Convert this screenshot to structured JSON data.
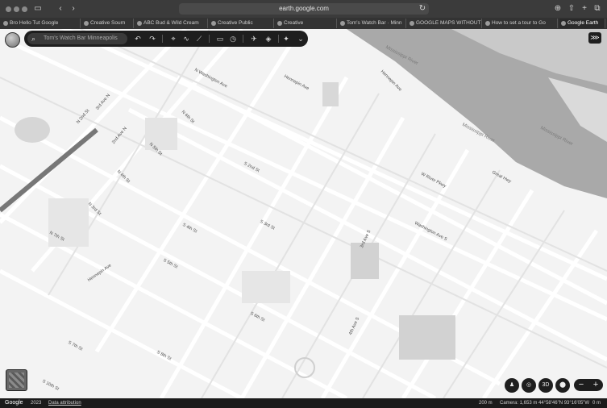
{
  "browser": {
    "url": "earth.google.com",
    "tabs": [
      {
        "label": "Bro Hello Tut Google"
      },
      {
        "label": "Creative Sourn"
      },
      {
        "label": "ABC Bud & Wild Cream"
      },
      {
        "label": "Creative Public"
      },
      {
        "label": "Creative"
      },
      {
        "label": "Tom's Watch Bar · Minn"
      },
      {
        "label": "GOOGLE MAPS WITHOUT"
      },
      {
        "label": "How to set a tour to Go"
      },
      {
        "label": "Google Earth"
      }
    ]
  },
  "toolbar": {
    "search_text": "Tom's Watch Bar",
    "search_context": "Minneapolis",
    "icons": [
      "search-icon",
      "undo-icon",
      "redo-icon",
      "place-icon",
      "path-icon",
      "measure-icon",
      "slideshow-icon",
      "history-icon",
      "satellite-icon",
      "layers-icon",
      "sparkle-icon",
      "chevron-down-icon"
    ]
  },
  "map": {
    "water_labels": [
      {
        "text": "Mississippi River"
      },
      {
        "text": "Mississippi River"
      },
      {
        "text": "Mississippi River"
      }
    ],
    "streets": [
      {
        "text": "N Washington Ave"
      },
      {
        "text": "N 2nd St"
      },
      {
        "text": "N 3rd St"
      },
      {
        "text": "N 4th St"
      },
      {
        "text": "N 5th St"
      },
      {
        "text": "N 6th St"
      },
      {
        "text": "N 7th St"
      },
      {
        "text": "2nd Ave N"
      },
      {
        "text": "3rd Ave N"
      },
      {
        "text": "Hennepin Ave"
      },
      {
        "text": "Hennepin Ave"
      },
      {
        "text": "S 2nd St"
      },
      {
        "text": "S 3rd St"
      },
      {
        "text": "S 4th St"
      },
      {
        "text": "S 5th St"
      },
      {
        "text": "S 6th St"
      },
      {
        "text": "S 7th St"
      },
      {
        "text": "S 8th St"
      },
      {
        "text": "S 10th St"
      },
      {
        "text": "3rd Ave S"
      },
      {
        "text": "4th Ave S"
      },
      {
        "text": "Washington Ave S"
      },
      {
        "text": "W River Pkwy"
      },
      {
        "text": "Great Hwy"
      },
      {
        "text": "Hennepin Ave"
      }
    ]
  },
  "controls": {
    "labels": [
      "3D"
    ],
    "zoom_out": "−",
    "zoom_in": "+"
  },
  "status": {
    "brand": "Google",
    "imagery": "2023",
    "attribution": "Data attribution",
    "scale": "200 m",
    "camera": "Camera: 1,653 m",
    "coords": "44°58'46\"N 93°16'05\"W",
    "elevation": "0 m"
  }
}
